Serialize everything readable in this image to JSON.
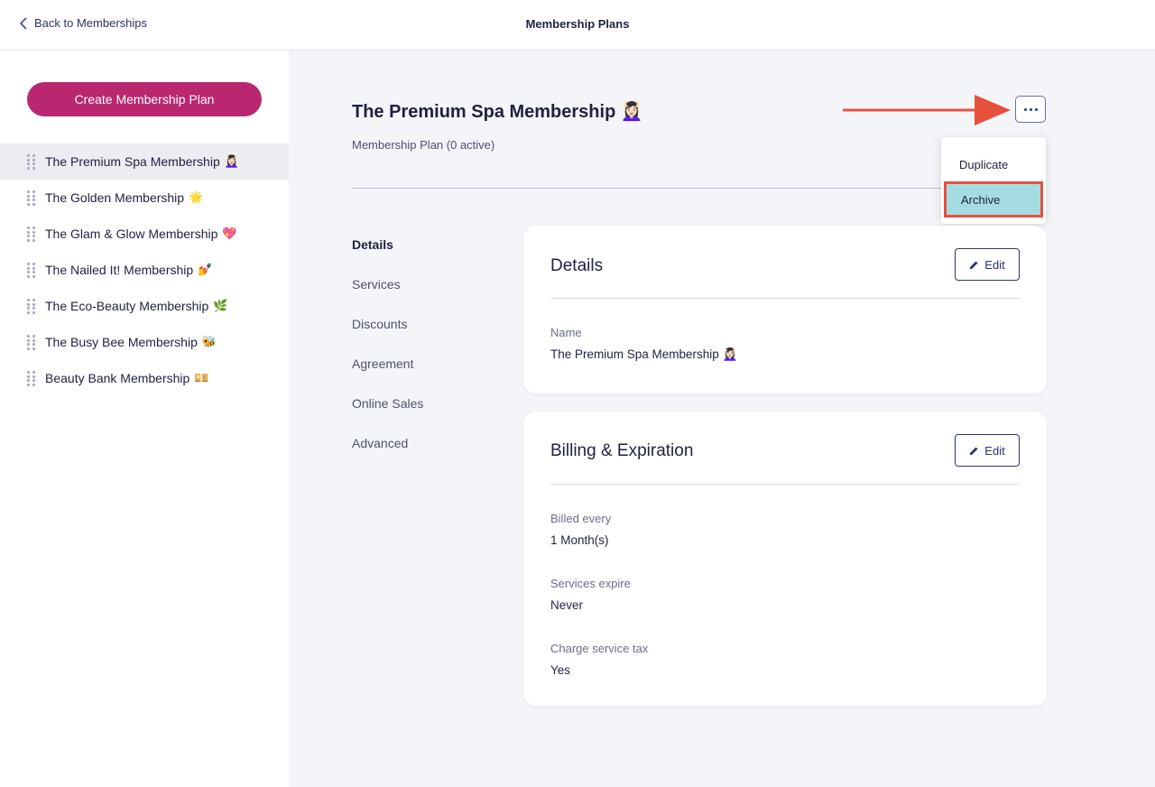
{
  "header": {
    "back_label": "Back to Memberships",
    "title": "Membership Plans"
  },
  "sidebar": {
    "create_label": "Create Membership Plan",
    "plans": [
      {
        "label": "The Premium Spa Membership",
        "emoji": "💆🏻‍♀️",
        "selected": true
      },
      {
        "label": "The Golden Membership",
        "emoji": "🌟",
        "selected": false
      },
      {
        "label": "The Glam & Glow Membership",
        "emoji": "💖",
        "selected": false
      },
      {
        "label": "The Nailed It! Membership",
        "emoji": "💅",
        "selected": false
      },
      {
        "label": "The Eco-Beauty Membership",
        "emoji": "🌿",
        "selected": false
      },
      {
        "label": "The Busy Bee Membership",
        "emoji": "🐝",
        "selected": false
      },
      {
        "label": "Beauty Bank Membership",
        "emoji": "💴",
        "selected": false
      }
    ]
  },
  "plan": {
    "title": "The Premium Spa Membership 💆🏻‍♀️",
    "subtitle": "Membership Plan (0 active)"
  },
  "menu": {
    "items": [
      "Duplicate",
      "Archive"
    ],
    "highlighted": "Archive"
  },
  "subnav": {
    "items": [
      "Details",
      "Services",
      "Discounts",
      "Agreement",
      "Online Sales",
      "Advanced"
    ],
    "active": "Details"
  },
  "details_card": {
    "title": "Details",
    "edit_label": "Edit",
    "fields": [
      {
        "label": "Name",
        "value": "The Premium Spa Membership 💆🏻‍♀️"
      }
    ]
  },
  "billing_card": {
    "title": "Billing & Expiration",
    "edit_label": "Edit",
    "fields": [
      {
        "label": "Billed every",
        "value": "1 Month(s)"
      },
      {
        "label": "Services expire",
        "value": "Never"
      },
      {
        "label": "Charge service tax",
        "value": "Yes"
      }
    ]
  },
  "colors": {
    "brand": "#b8276f",
    "navy": "#2c3370",
    "highlight": "#a5dce2",
    "annotation_red": "#e8503e"
  },
  "icons": [
    "chevron-left-icon",
    "drag-handle-icon",
    "more-options-icon",
    "pencil-icon",
    "arrow-annotation"
  ]
}
